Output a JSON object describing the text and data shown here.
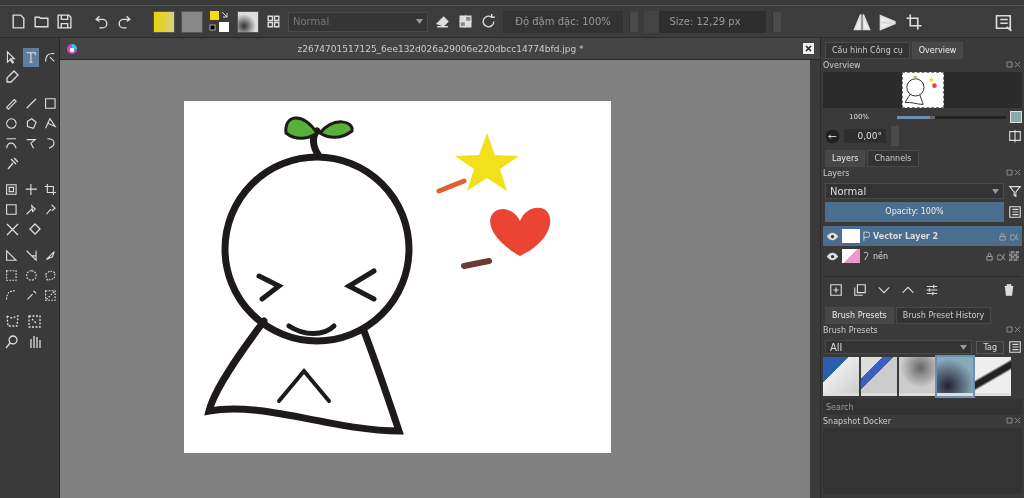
{
  "toolbar": {
    "blend_mode": "Normal",
    "opacity_field": "Độ đậm đặc: 100%",
    "size_field": "Size: 12,29 px"
  },
  "toolbox": {
    "rows": [
      [
        {
          "selected": false
        },
        {
          "selected": true
        },
        {
          "selected": false
        }
      ],
      [
        {
          "selected": false
        }
      ],
      [
        {
          "selected": false
        },
        {
          "selected": false
        },
        {
          "selected": false
        }
      ],
      [
        {
          "selected": false
        },
        {
          "selected": false
        },
        {
          "selected": false
        }
      ],
      [
        {
          "selected": false
        },
        {
          "selected": false
        },
        {
          "selected": false
        }
      ],
      [
        {
          "selected": false
        }
      ],
      [
        {
          "selected": false
        },
        {
          "selected": false
        },
        {
          "selected": false
        }
      ],
      [
        {
          "selected": false
        },
        {
          "selected": false
        },
        {
          "selected": false
        }
      ],
      [
        {
          "selected": false
        },
        {
          "selected": false
        }
      ],
      [
        {
          "selected": false
        },
        {
          "selected": false
        },
        {
          "selected": false
        }
      ],
      [
        {
          "selected": false
        },
        {
          "selected": false
        },
        {
          "selected": false
        }
      ],
      [
        {
          "selected": false
        },
        {
          "selected": false
        },
        {
          "selected": false
        }
      ],
      [
        {
          "selected": false
        },
        {
          "selected": false
        }
      ],
      [
        {
          "selected": false
        },
        {
          "selected": false
        }
      ]
    ]
  },
  "document": {
    "title": "z2674701517125_6ee132d026a29006e220dbcc14774bfd.jpg *"
  },
  "dock": {
    "top_tabs": [
      {
        "label": "Cấu hình Công cụ",
        "selected": false
      },
      {
        "label": "Overview",
        "selected": true
      }
    ],
    "overview": {
      "title": "Overview",
      "zoom": "100%",
      "zoom_slider": {
        "level": 0.3
      },
      "rotation": "0,00°"
    },
    "layer_tabs": [
      {
        "label": "Layers",
        "selected": true
      },
      {
        "label": "Channels",
        "selected": false
      }
    ],
    "layers": {
      "title": "Layers",
      "blend_mode": "Normal",
      "opacity": {
        "label": "Opacity:  100%",
        "level": 1
      },
      "items": [
        {
          "name": "Vector Layer 2",
          "kind": "vector",
          "selected": true
        },
        {
          "name": "nền",
          "kind": "paint",
          "selected": false
        }
      ]
    },
    "brush_tabs": [
      {
        "label": "Brush Presets",
        "selected": true
      },
      {
        "label": "Brush Preset History",
        "selected": false
      }
    ],
    "brush_presets": {
      "title": "Brush Presets",
      "filter": "All",
      "tag": "Tag",
      "search_placeholder": "Search",
      "items": [
        {
          "kind": "eraser",
          "selected": false
        },
        {
          "kind": "blue-eraser",
          "selected": false
        },
        {
          "kind": "airbrush",
          "selected": false
        },
        {
          "kind": "blender",
          "selected": true
        },
        {
          "kind": "pencil",
          "selected": false
        }
      ]
    },
    "snapshot": {
      "title": "Snapshot Docker"
    }
  }
}
